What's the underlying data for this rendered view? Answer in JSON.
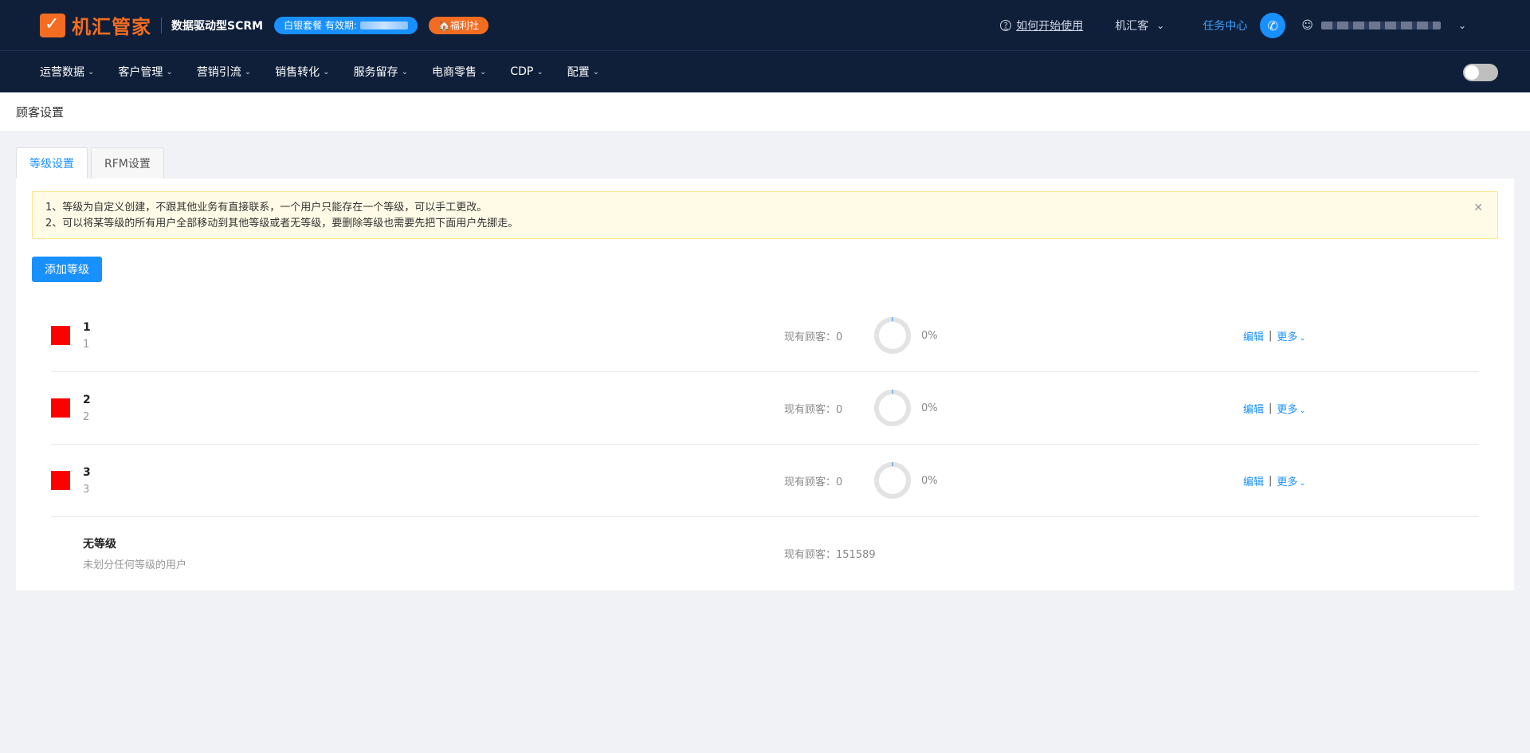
{
  "header": {
    "brand": "机汇管家",
    "subtitle": "数据驱动型SCRM",
    "package_label": "白银套餐 有效期:",
    "welfare_label": "🏠福利社",
    "help_link": "如何开始使用",
    "shop_name": "机汇客",
    "task_center": "任务中心"
  },
  "nav": {
    "items": [
      {
        "label": "运营数据"
      },
      {
        "label": "客户管理"
      },
      {
        "label": "营销引流"
      },
      {
        "label": "销售转化"
      },
      {
        "label": "服务留存"
      },
      {
        "label": "电商零售"
      },
      {
        "label": "CDP"
      },
      {
        "label": "配置"
      }
    ]
  },
  "page": {
    "title": "顾客设置",
    "tabs": [
      {
        "label": "等级设置",
        "active": true
      },
      {
        "label": "RFM设置",
        "active": false
      }
    ],
    "alert_lines": [
      "1、等级为自定义创建，不跟其他业务有直接联系，一个用户只能存在一个等级，可以手工更改。",
      "2、可以将某等级的所有用户全部移动到其他等级或者无等级，要删除等级也需要先把下面用户先挪走。"
    ],
    "add_button": "添加等级",
    "levels": [
      {
        "name": "1",
        "desc": "1",
        "count_text": "现有顾客：0",
        "percent": "0%",
        "color": "#ff0000",
        "edit": "编辑",
        "more": "更多"
      },
      {
        "name": "2",
        "desc": "2",
        "count_text": "现有顾客：0",
        "percent": "0%",
        "color": "#ff0000",
        "edit": "编辑",
        "more": "更多"
      },
      {
        "name": "3",
        "desc": "3",
        "count_text": "现有顾客：0",
        "percent": "0%",
        "color": "#ff0000",
        "edit": "编辑",
        "more": "更多"
      }
    ],
    "no_level": {
      "name": "无等级",
      "desc": "未划分任何等级的用户",
      "count_text": "现有顾客：151589"
    }
  },
  "colors": {
    "accent": "#1890ff",
    "brand": "#f36c21",
    "header_bg": "#0f1f3a"
  }
}
